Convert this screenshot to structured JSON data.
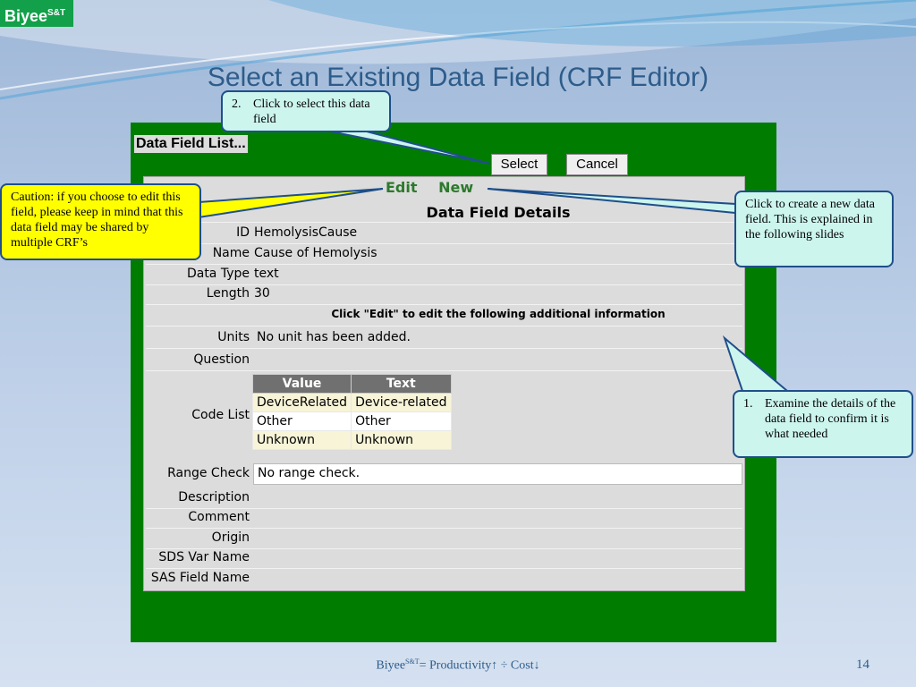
{
  "brand": {
    "name": "Biyee",
    "mark": "S&T"
  },
  "slide_title": "Select an Existing Data Field (CRF Editor)",
  "panel": {
    "header": "Data Field List...",
    "select_label": "Select",
    "cancel_label": "Cancel",
    "edit_label": "Edit",
    "new_label": "New",
    "details_title": "Data Field Details",
    "fields": {
      "id": {
        "label": "ID",
        "value": "HemolysisCause"
      },
      "name": {
        "label": "Name",
        "value": "Cause of Hemolysis"
      },
      "data_type": {
        "label": "Data Type",
        "value": "text"
      },
      "length": {
        "label": "Length",
        "value": "30"
      }
    },
    "edit_hint": "Click \"Edit\" to edit the following additional information",
    "units": {
      "label": "Units",
      "value": "No unit has been added."
    },
    "question": {
      "label": "Question",
      "value": ""
    },
    "code_list": {
      "label": "Code List",
      "headers": [
        "Value",
        "Text"
      ],
      "rows": [
        [
          "DeviceRelated",
          "Device-related"
        ],
        [
          "Other",
          "Other"
        ],
        [
          "Unknown",
          "Unknown"
        ]
      ]
    },
    "range_check": {
      "label": "Range Check",
      "value": "No range check."
    },
    "description": {
      "label": "Description"
    },
    "comment": {
      "label": "Comment"
    },
    "origin": {
      "label": "Origin"
    },
    "sds_var_name": {
      "label": "SDS Var Name"
    },
    "sas_field_name": {
      "label": "SAS Field Name"
    }
  },
  "callouts": {
    "select": {
      "num": "2.",
      "text": "Click to select this data field"
    },
    "caution": {
      "text": "Caution: if you choose to edit this field, please keep in mind that this data field may be shared by multiple CRF’s"
    },
    "new": {
      "text": "Click to create a new data field. This is explained in the following slides"
    },
    "examine": {
      "num": "1.",
      "text": "Examine the details of the data field to confirm it is what needed"
    }
  },
  "footer": {
    "brand": "Biyee",
    "mark": "S&T",
    "formula": "= Productivity↑ ÷ Cost↓"
  },
  "page_number": "14"
}
